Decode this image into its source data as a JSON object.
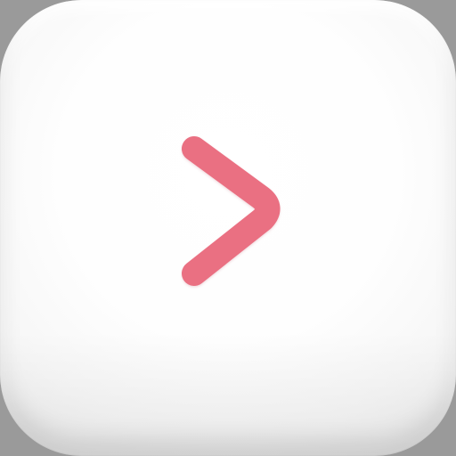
{
  "app_icon": {
    "shape": "rounded-square",
    "background_color": "#ffffff",
    "accent_color": "#ea6f82",
    "icon_name": "chevron-right-icon"
  }
}
